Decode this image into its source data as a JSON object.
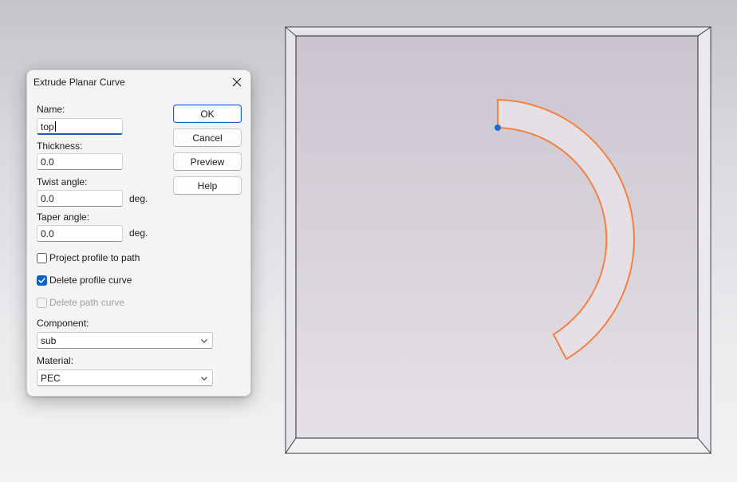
{
  "dialog": {
    "title": "Extrude Planar Curve",
    "name_label": "Name:",
    "name_value": "top",
    "thickness_label": "Thickness:",
    "thickness_value": "0.0",
    "twist_label": "Twist angle:",
    "twist_value": "0.0",
    "twist_unit": "deg.",
    "taper_label": "Taper angle:",
    "taper_value": "0.0",
    "taper_unit": "deg.",
    "buttons": {
      "ok": "OK",
      "cancel": "Cancel",
      "preview": "Preview",
      "help": "Help"
    },
    "checkboxes": {
      "project_profile": {
        "label": "Project profile to path",
        "checked": false,
        "enabled": true
      },
      "delete_profile": {
        "label": "Delete profile curve",
        "checked": true,
        "enabled": true
      },
      "delete_path": {
        "label": "Delete path curve",
        "checked": false,
        "enabled": false
      }
    },
    "component_label": "Component:",
    "component_value": "sub",
    "material_label": "Material:",
    "material_value": "PEC"
  },
  "colors": {
    "accent": "#0f62c4",
    "curve": "#f5813f",
    "curve_fill": "#e4e0e6",
    "point": "#1a6fd6"
  },
  "icons": {
    "close": "close-icon",
    "checkmark": "checkmark-icon",
    "dropdown": "chevron-down-icon"
  }
}
